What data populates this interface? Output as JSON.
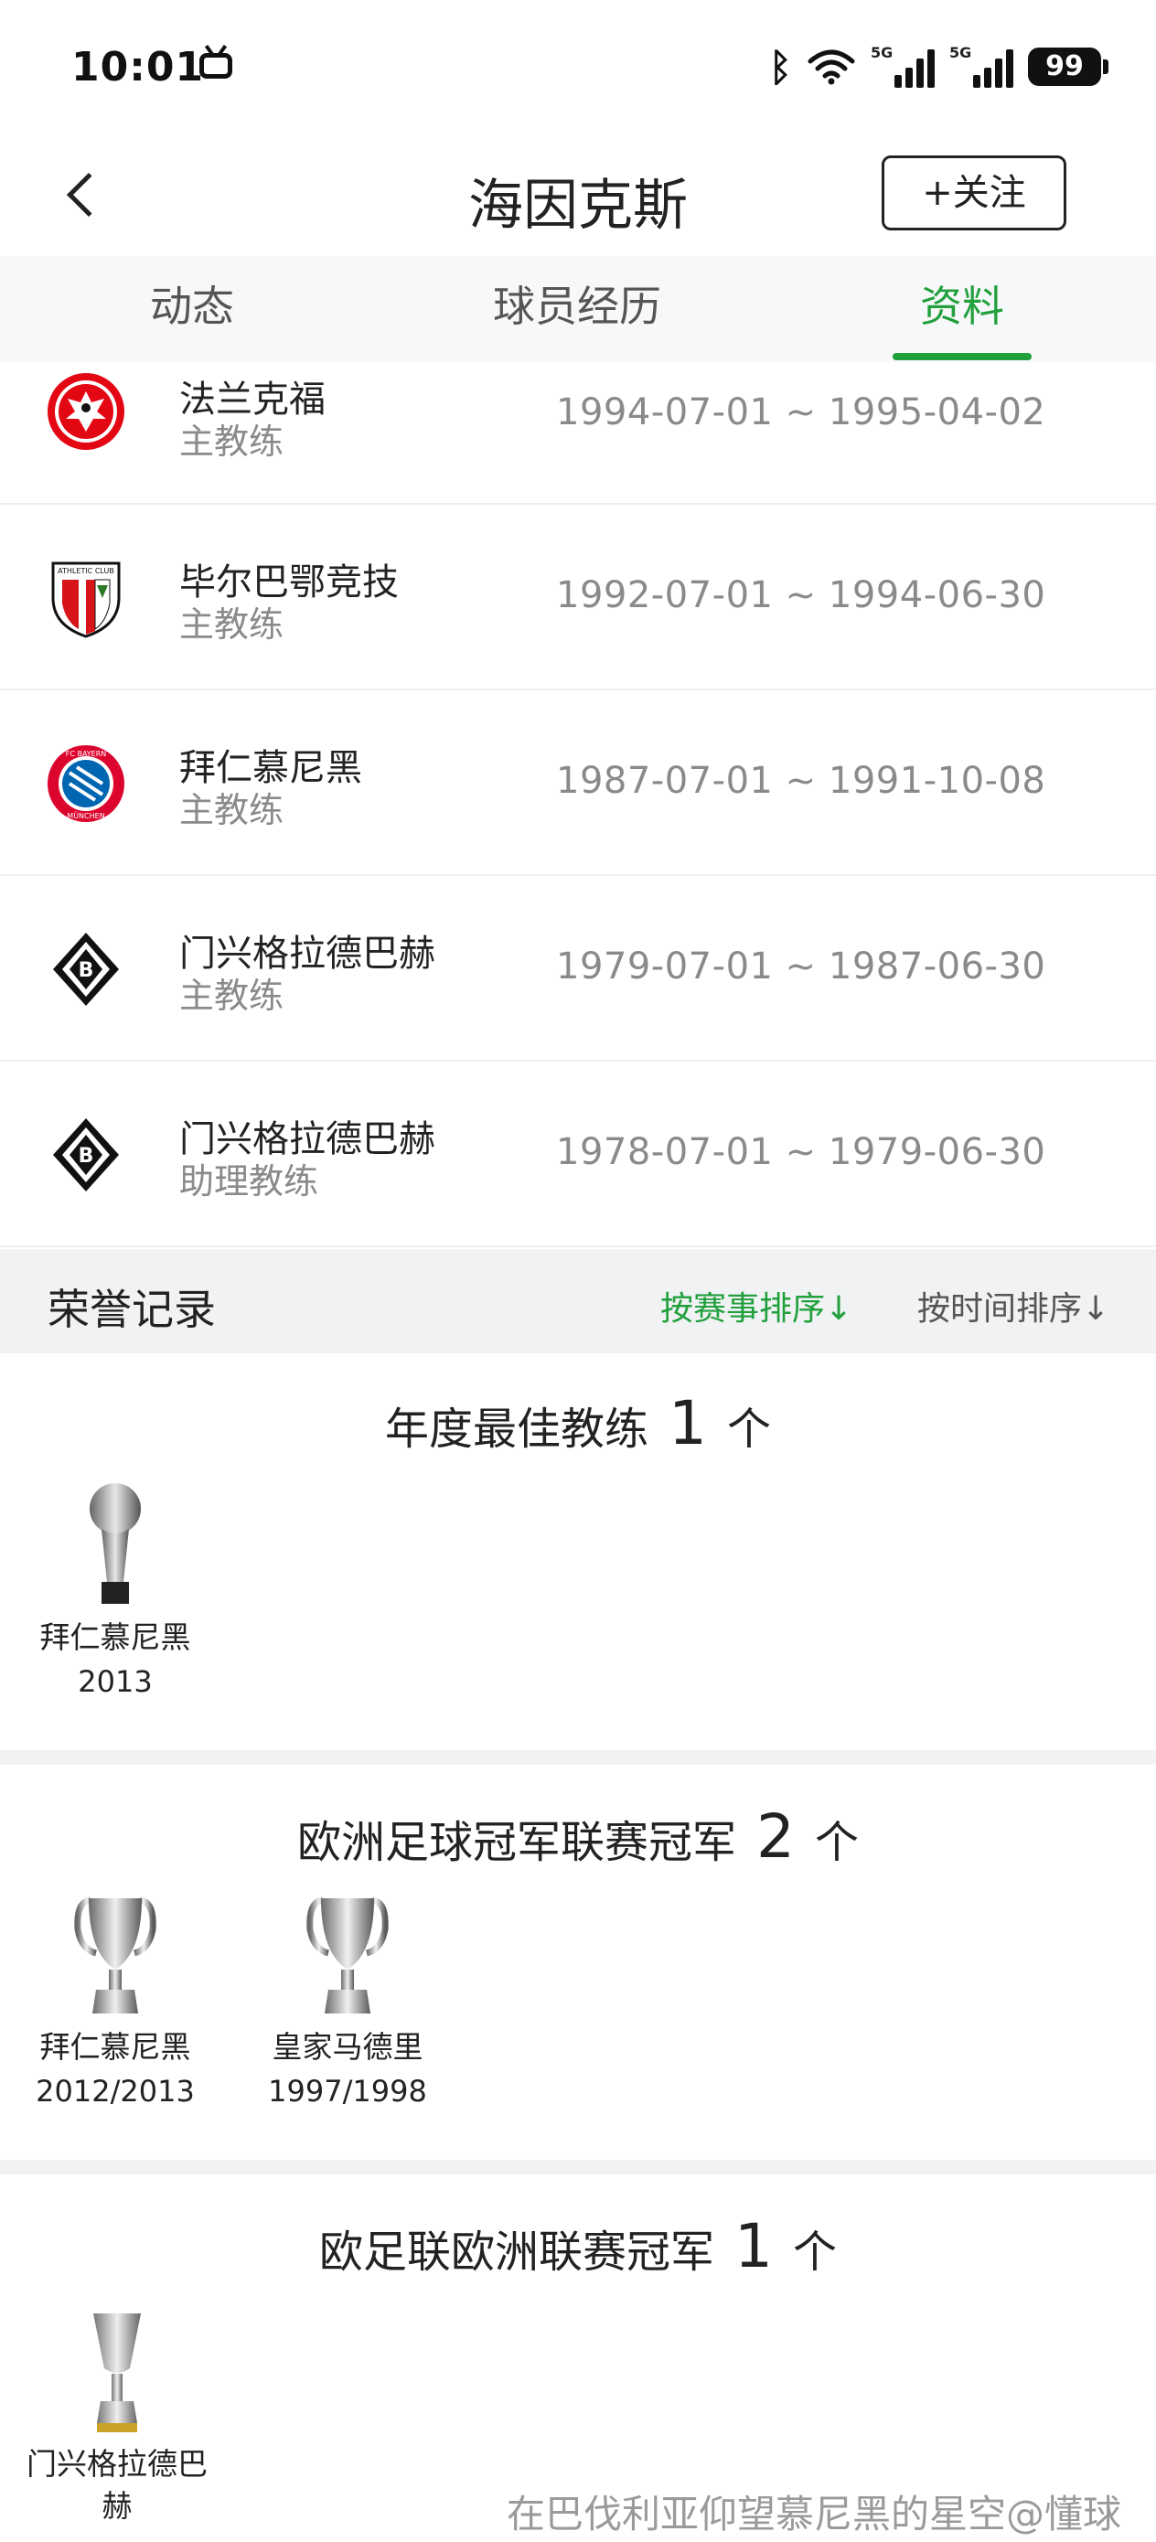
{
  "status_bar": {
    "time": "10:01",
    "battery": "99",
    "network_label": "5G"
  },
  "header": {
    "title": "海因克斯",
    "follow_label": "+关注"
  },
  "tabs": [
    {
      "label": "动态",
      "active": false
    },
    {
      "label": "球员经历",
      "active": false
    },
    {
      "label": "资料",
      "active": true
    }
  ],
  "career": [
    {
      "club": "法兰克福",
      "role": "主教练",
      "dates": "1994-07-01 ~ 1995-04-02",
      "logo": "eagle-crest-icon"
    },
    {
      "club": "毕尔巴鄂竞技",
      "role": "主教练",
      "dates": "1992-07-01 ~ 1994-06-30",
      "logo": "athletic-club-crest-icon"
    },
    {
      "club": "拜仁慕尼黑",
      "role": "主教练",
      "dates": "1987-07-01 ~ 1991-10-08",
      "logo": "bayern-crest-icon"
    },
    {
      "club": "门兴格拉德巴赫",
      "role": "主教练",
      "dates": "1979-07-01 ~ 1987-06-30",
      "logo": "gladbach-crest-icon"
    },
    {
      "club": "门兴格拉德巴赫",
      "role": "助理教练",
      "dates": "1978-07-01 ~ 1979-06-30",
      "logo": "gladbach-crest-icon"
    }
  ],
  "honors": {
    "title": "荣誉记录",
    "sort_by_competition": "按赛事排序↓",
    "sort_by_time": "按时间排序↓",
    "unit": "个",
    "sections": [
      {
        "name": "年度最佳教练",
        "count": "1",
        "items": [
          {
            "team": "拜仁慕尼黑",
            "season": "2013"
          }
        ]
      },
      {
        "name": "欧洲足球冠军联赛冠军",
        "count": "2",
        "items": [
          {
            "team": "拜仁慕尼黑",
            "season": "2012/2013"
          },
          {
            "team": "皇家马德里",
            "season": "1997/1998"
          }
        ]
      },
      {
        "name": "欧足联欧洲联赛冠军",
        "count": "1",
        "items": [
          {
            "team": "门兴格拉德巴赫",
            "season": ""
          }
        ]
      }
    ]
  },
  "watermark": "在巴伐利亚仰望慕尼黑的星空@懂球帝",
  "colors": {
    "accent": "#21a03c",
    "muted_text": "#8a8a8a",
    "section_bg": "#f0f2f4"
  }
}
